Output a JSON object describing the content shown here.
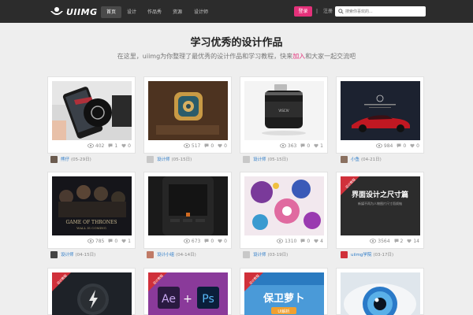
{
  "header": {
    "logo_text": "UIIMG",
    "nav": [
      "首页",
      "设计",
      "作品秀",
      "资源",
      "设计师"
    ],
    "login": "登录",
    "separator": "|",
    "register": "注册",
    "search_placeholder": "搜索你喜欢的..."
  },
  "page": {
    "title": "学习优秀的设计作品",
    "subtitle_before": "在这里，uiimg为你整理了最优秀的设计作品和学习教程，快来",
    "subtitle_highlight": "加入",
    "subtitle_after": "和大家一起交流吧"
  },
  "colors": {
    "accent": "#e4317a",
    "header_bg": "#2c2c2c",
    "link": "#2a7ac8"
  },
  "posts": [
    {
      "views": "402",
      "comments": "1",
      "likes": "0",
      "author": "熊仔",
      "date": "(05-29日)",
      "avatar": "#6b5b4f"
    },
    {
      "views": "517",
      "comments": "0",
      "likes": "0",
      "author": "设计师",
      "date": "(05-15日)",
      "avatar": "#c8c8c8"
    },
    {
      "views": "363",
      "comments": "0",
      "likes": "1",
      "author": "设计师",
      "date": "(05-15日)",
      "avatar": "#c8c8c8"
    },
    {
      "views": "984",
      "comments": "0",
      "likes": "0",
      "author": "小鱼",
      "date": "(04-21日)",
      "avatar": "#8a7060"
    },
    {
      "views": "785",
      "comments": "0",
      "likes": "1",
      "author": "设计师",
      "date": "(04-15日)",
      "avatar": "#444444"
    },
    {
      "views": "673",
      "comments": "0",
      "likes": "0",
      "author": "设计小组",
      "date": "(04-14日)",
      "avatar": "#c07a66"
    },
    {
      "views": "1310",
      "comments": "0",
      "likes": "4",
      "author": "设计师",
      "date": "(03-19日)",
      "avatar": "#c8c8c8"
    },
    {
      "views": "3564",
      "comments": "2",
      "likes": "14",
      "author": "uiimg学院",
      "date": "(03-17日)",
      "avatar": "#d0303a"
    }
  ],
  "thumb_labels": {
    "card8_title": "界面设计之尺寸篇",
    "card8_sub": "新媒不再为人物图片尺寸而烦恼",
    "corner_tag": "设计教程",
    "game_title": "GAME OF THRONES",
    "game_sub": "WALL IS COMING",
    "ae": "Ae",
    "plus": "+",
    "ps": "Ps",
    "carrot": "保卫萝卜",
    "carrot_small": "UI解析",
    "bottle_label": "VISCIV"
  }
}
